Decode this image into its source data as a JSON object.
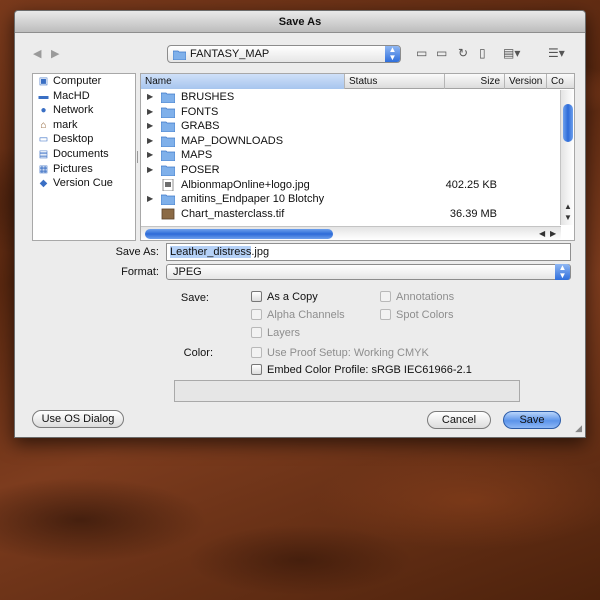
{
  "window": {
    "title": "Save As"
  },
  "toolbar": {
    "path_label": "FANTASY_MAP"
  },
  "sidebar": {
    "items": [
      {
        "label": "Computer"
      },
      {
        "label": "MacHD"
      },
      {
        "label": "Network"
      },
      {
        "label": "mark"
      },
      {
        "label": "Desktop"
      },
      {
        "label": "Documents"
      },
      {
        "label": "Pictures"
      },
      {
        "label": "Version Cue"
      }
    ]
  },
  "file_list": {
    "columns": [
      "Name",
      "Status",
      "Size",
      "Version",
      "Co"
    ],
    "rows": [
      {
        "name": "BRUSHES",
        "size": ""
      },
      {
        "name": "FONTS",
        "size": ""
      },
      {
        "name": "GRABS",
        "size": ""
      },
      {
        "name": "MAP_DOWNLOADS",
        "size": ""
      },
      {
        "name": "MAPS",
        "size": ""
      },
      {
        "name": "POSER",
        "size": ""
      },
      {
        "name": "AlbionmapOnline+logo.jpg",
        "size": "402.25 KB"
      },
      {
        "name": "amitins_Endpaper 10 Blotchy",
        "size": ""
      },
      {
        "name": "Chart_masterclass.tif",
        "size": "36.39 MB"
      }
    ]
  },
  "save_as": {
    "label": "Save As:",
    "value_selected": "Leather_distress",
    "value_ext": ".jpg"
  },
  "format": {
    "label": "Format:",
    "value": "JPEG"
  },
  "options": {
    "save_label": "Save:",
    "as_a_copy": "As a Copy",
    "annotations": "Annotations",
    "alpha_channels": "Alpha Channels",
    "spot_colors": "Spot Colors",
    "layers": "Layers",
    "color_label": "Color:",
    "use_proof_setup": "Use Proof Setup:  Working CMYK",
    "embed_color_profile": "Embed Color Profile:  sRGB IEC61966-2.1"
  },
  "buttons": {
    "use_os_dialog": "Use OS Dialog",
    "cancel": "Cancel",
    "save": "Save"
  }
}
